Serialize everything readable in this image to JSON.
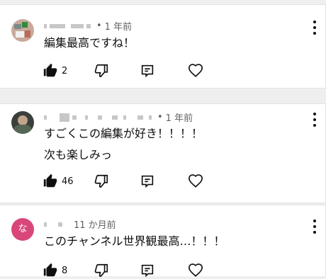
{
  "comments": [
    {
      "avatar_icon": "user-avatar-image",
      "time": "1 年前",
      "lines": [
        "編集最高ですね！"
      ],
      "likes": "2",
      "more_icon": "more-vertical-icon"
    },
    {
      "avatar_icon": "user-avatar-image",
      "time": "1 年前",
      "lines": [
        "すごくこの編集が好き！！！！",
        "次も楽しみっ"
      ],
      "likes": "46",
      "more_icon": "more-vertical-icon"
    },
    {
      "avatar_letter": "な",
      "avatar_color": "#d9467a",
      "time": "11 か月前",
      "lines": [
        "このチャンネル世界観最高…！！！"
      ],
      "likes": "8",
      "more_icon": "more-vertical-icon"
    }
  ],
  "icons": {
    "like": "thumb-up-icon",
    "dislike": "thumb-down-icon",
    "reply": "reply-comment-icon",
    "heart": "heart-icon"
  }
}
